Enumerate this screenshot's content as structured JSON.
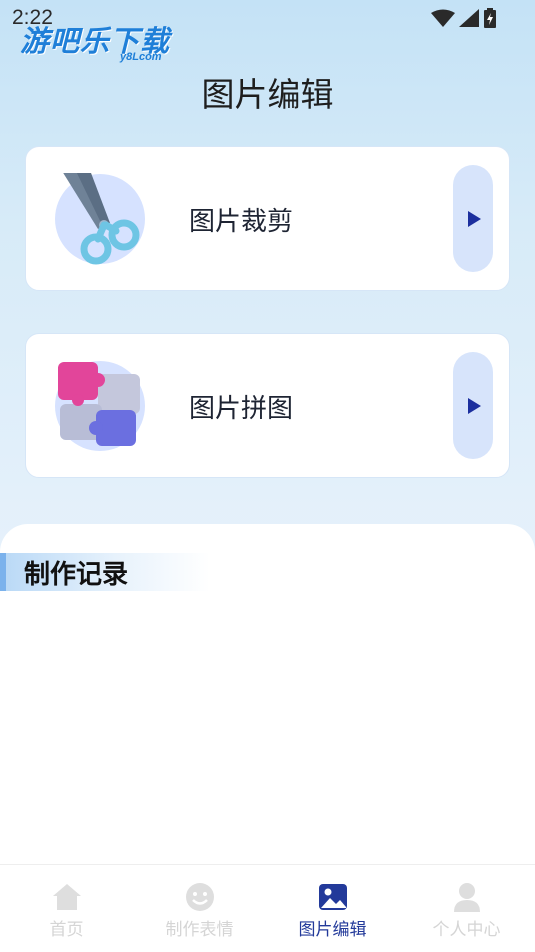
{
  "status_bar": {
    "time": "2:22"
  },
  "watermark": {
    "title": "游吧乐下载",
    "subtitle": "y8Lcom"
  },
  "header": {
    "title": "图片编辑"
  },
  "cards": [
    {
      "label": "图片裁剪",
      "icon": "scissors-icon"
    },
    {
      "label": "图片拼图",
      "icon": "puzzle-icon"
    }
  ],
  "records": {
    "title": "制作记录"
  },
  "tabs": [
    {
      "label": "首页",
      "icon": "home-icon",
      "active": false
    },
    {
      "label": "制作表情",
      "icon": "smiley-icon",
      "active": false
    },
    {
      "label": "图片编辑",
      "icon": "image-icon",
      "active": true
    },
    {
      "label": "个人中心",
      "icon": "person-icon",
      "active": false
    }
  ],
  "colors": {
    "accent": "#233a9a",
    "arrow_button_bg": "#d7e4fb",
    "inactive_tab": "#d5d5d5",
    "header_gradient_top": "#c4e2f6"
  }
}
